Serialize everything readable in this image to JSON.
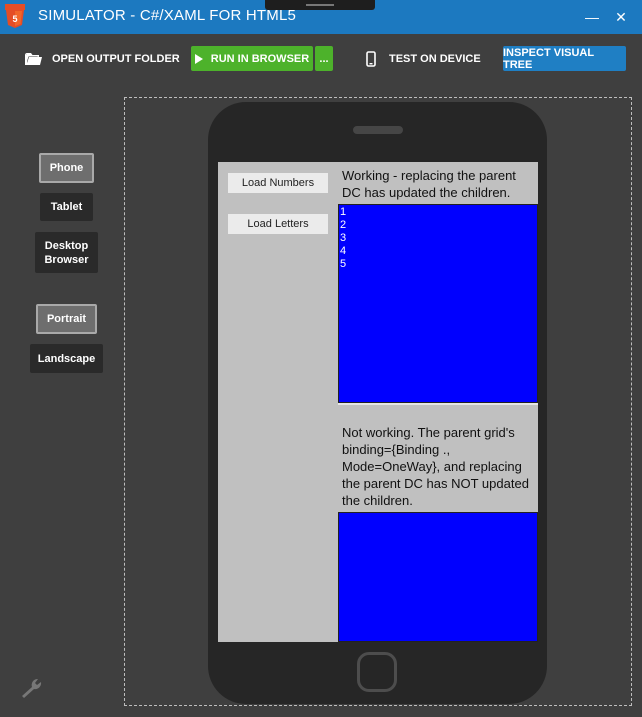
{
  "window": {
    "title": "SIMULATOR - C#/XAML FOR HTML5",
    "minimize_glyph": "—",
    "maximize_glyph": "□",
    "close_glyph": "✕"
  },
  "toolbar": {
    "open_output_folder": "OPEN OUTPUT FOLDER",
    "run_in_browser": "RUN IN BROWSER",
    "more": "...",
    "test_on_device": "TEST ON DEVICE",
    "inspect_visual_tree": "INSPECT VISUAL TREE"
  },
  "device_options": {
    "phone": "Phone",
    "tablet": "Tablet",
    "desktop_line1": "Desktop",
    "desktop_line2": "Browser",
    "selected_device": "Phone"
  },
  "orientation_options": {
    "portrait": "Portrait",
    "landscape": "Landscape",
    "selected_orientation": "Portrait"
  },
  "app": {
    "load_numbers": "Load Numbers",
    "load_letters": "Load Letters",
    "working_text": "Working - replacing the parent DC has updated the children.",
    "working_items": [
      "1",
      "2",
      "3",
      "4",
      "5"
    ],
    "not_working_text": "Not working. The parent grid's binding={Binding ., Mode=OneWay}, and replacing the parent DC has NOT updated the children.",
    "not_working_items": []
  },
  "icons": {
    "app": "html5-logo-icon",
    "folder": "folder-icon",
    "play": "play-icon",
    "device": "phone-icon",
    "settings": "wrench-icon"
  },
  "colors": {
    "titlebar": "#1c79c0",
    "run_button": "#4db22b",
    "inspect_button": "#1f7fc4",
    "list_background": "#0000ff"
  }
}
